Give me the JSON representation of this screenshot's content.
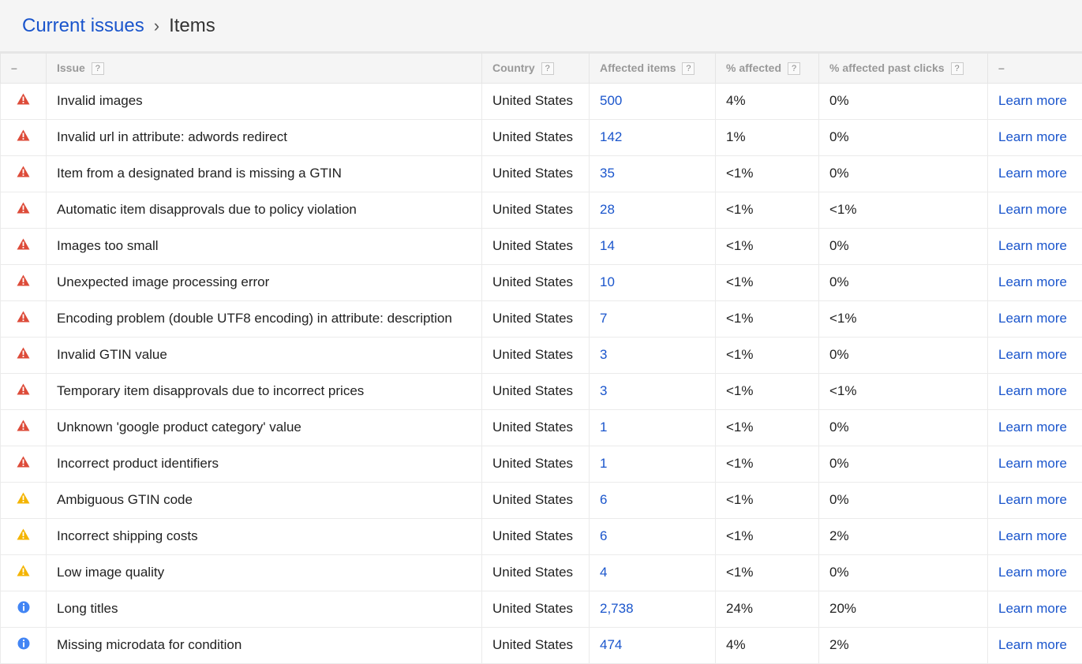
{
  "breadcrumb": {
    "parent": "Current issues",
    "separator": "›",
    "current": "Items"
  },
  "colors": {
    "error": "#dd4b39",
    "warning": "#f4b400",
    "info": "#4285f4",
    "link": "#1a55cc"
  },
  "columns": {
    "severity": "–",
    "issue": "Issue",
    "country": "Country",
    "affected_items": "Affected items",
    "pct_affected": "% affected",
    "pct_past_clicks": "% affected past clicks",
    "action": "–",
    "help": "?"
  },
  "rows": [
    {
      "severity": "error",
      "issue": "Invalid images",
      "country": "United States",
      "affected": "500",
      "pct": "4%",
      "clicks": "0%",
      "action": "Learn more"
    },
    {
      "severity": "error",
      "issue": "Invalid url in attribute: adwords redirect",
      "country": "United States",
      "affected": "142",
      "pct": "1%",
      "clicks": "0%",
      "action": "Learn more"
    },
    {
      "severity": "error",
      "issue": "Item from a designated brand is missing a GTIN",
      "country": "United States",
      "affected": "35",
      "pct": "<1%",
      "clicks": "0%",
      "action": "Learn more"
    },
    {
      "severity": "error",
      "issue": "Automatic item disapprovals due to policy violation",
      "country": "United States",
      "affected": "28",
      "pct": "<1%",
      "clicks": "<1%",
      "action": "Learn more"
    },
    {
      "severity": "error",
      "issue": "Images too small",
      "country": "United States",
      "affected": "14",
      "pct": "<1%",
      "clicks": "0%",
      "action": "Learn more"
    },
    {
      "severity": "error",
      "issue": "Unexpected image processing error",
      "country": "United States",
      "affected": "10",
      "pct": "<1%",
      "clicks": "0%",
      "action": "Learn more"
    },
    {
      "severity": "error",
      "issue": "Encoding problem (double UTF8 encoding) in attribute: description",
      "country": "United States",
      "affected": "7",
      "pct": "<1%",
      "clicks": "<1%",
      "action": "Learn more"
    },
    {
      "severity": "error",
      "issue": "Invalid GTIN value",
      "country": "United States",
      "affected": "3",
      "pct": "<1%",
      "clicks": "0%",
      "action": "Learn more"
    },
    {
      "severity": "error",
      "issue": "Temporary item disapprovals due to incorrect prices",
      "country": "United States",
      "affected": "3",
      "pct": "<1%",
      "clicks": "<1%",
      "action": "Learn more"
    },
    {
      "severity": "error",
      "issue": "Unknown 'google product category' value",
      "country": "United States",
      "affected": "1",
      "pct": "<1%",
      "clicks": "0%",
      "action": "Learn more"
    },
    {
      "severity": "error",
      "issue": "Incorrect product identifiers",
      "country": "United States",
      "affected": "1",
      "pct": "<1%",
      "clicks": "0%",
      "action": "Learn more"
    },
    {
      "severity": "warning",
      "issue": "Ambiguous GTIN code",
      "country": "United States",
      "affected": "6",
      "pct": "<1%",
      "clicks": "0%",
      "action": "Learn more"
    },
    {
      "severity": "warning",
      "issue": "Incorrect shipping costs",
      "country": "United States",
      "affected": "6",
      "pct": "<1%",
      "clicks": "2%",
      "action": "Learn more"
    },
    {
      "severity": "warning",
      "issue": "Low image quality",
      "country": "United States",
      "affected": "4",
      "pct": "<1%",
      "clicks": "0%",
      "action": "Learn more"
    },
    {
      "severity": "info",
      "issue": "Long titles",
      "country": "United States",
      "affected": "2,738",
      "pct": "24%",
      "clicks": "20%",
      "action": "Learn more"
    },
    {
      "severity": "info",
      "issue": "Missing microdata for condition",
      "country": "United States",
      "affected": "474",
      "pct": "4%",
      "clicks": "2%",
      "action": "Learn more"
    }
  ]
}
